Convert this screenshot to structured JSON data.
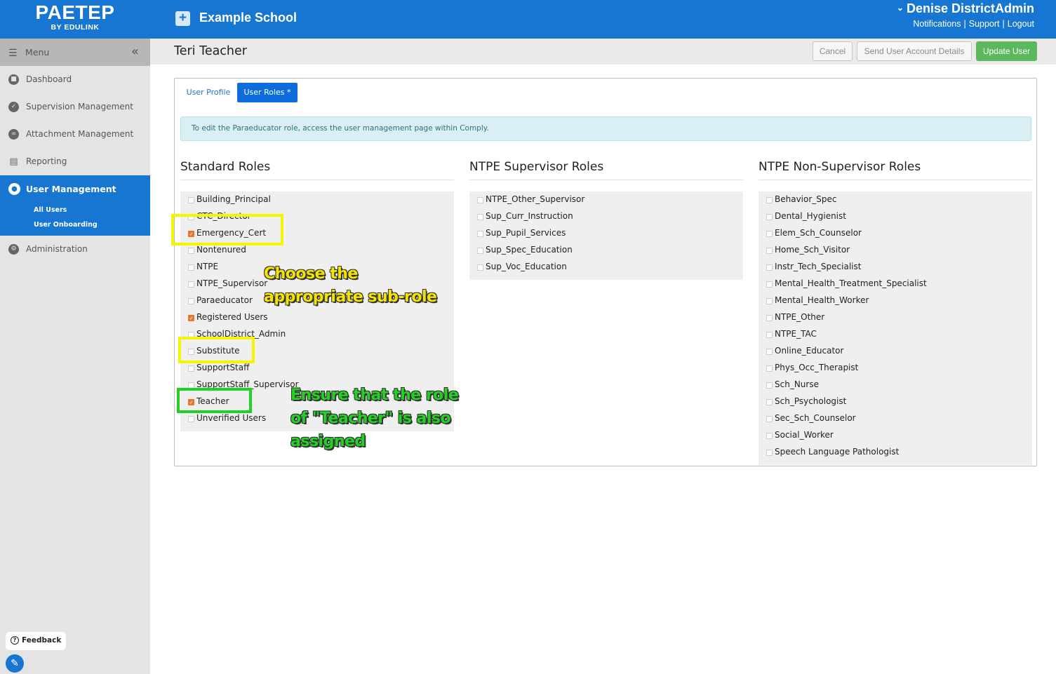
{
  "brand": {
    "logo": "PAETEP",
    "tagline": "BY EDULINK"
  },
  "header": {
    "school_name": "Example School",
    "user_name": "Denise DistrictAdmin",
    "links": [
      "Notifications",
      "Support",
      "Logout"
    ]
  },
  "sidebar": {
    "menu_label": "Menu",
    "items": [
      {
        "label": "Dashboard",
        "icon": "dashboard-icon"
      },
      {
        "label": "Supervision Management",
        "icon": "check-circle-icon"
      },
      {
        "label": "Attachment Management",
        "icon": "paperclip-icon"
      },
      {
        "label": "Reporting",
        "icon": "bar-chart-icon"
      },
      {
        "label": "User Management",
        "icon": "user-icon",
        "active": true
      },
      {
        "label": "Administration",
        "icon": "gear-icon"
      }
    ],
    "sub_items": [
      "All Users",
      "User Onboarding"
    ],
    "feedback_label": "Feedback"
  },
  "page": {
    "title": "Teri Teacher",
    "buttons": {
      "cancel": "Cancel",
      "send": "Send User Account Details",
      "update": "Update User"
    }
  },
  "tabs": [
    {
      "label": "User Profile",
      "active": false
    },
    {
      "label": "User Roles *",
      "active": true
    }
  ],
  "info_message": "To edit the Paraeducator role, access the user management page within Comply.",
  "columns": [
    {
      "title": "Standard Roles",
      "roles": [
        {
          "label": "Building_Principal",
          "checked": false
        },
        {
          "label": "CTC_Director",
          "checked": false
        },
        {
          "label": "Emergency_Cert",
          "checked": true
        },
        {
          "label": "Nontenured",
          "checked": false
        },
        {
          "label": "NTPE",
          "checked": false
        },
        {
          "label": "NTPE_Supervisor",
          "checked": false
        },
        {
          "label": "Paraeducator",
          "checked": false
        },
        {
          "label": "Registered Users",
          "checked": true
        },
        {
          "label": "SchoolDistrict_Admin",
          "checked": false
        },
        {
          "label": "Substitute",
          "checked": false
        },
        {
          "label": "SupportStaff",
          "checked": false
        },
        {
          "label": "SupportStaff_Supervisor",
          "checked": false
        },
        {
          "label": "Teacher",
          "checked": true
        },
        {
          "label": "Unverified Users",
          "checked": false
        }
      ]
    },
    {
      "title": "NTPE Supervisor Roles",
      "roles": [
        {
          "label": "NTPE_Other_Supervisor",
          "checked": false
        },
        {
          "label": "Sup_Curr_Instruction",
          "checked": false
        },
        {
          "label": "Sup_Pupil_Services",
          "checked": false
        },
        {
          "label": "Sup_Spec_Education",
          "checked": false
        },
        {
          "label": "Sup_Voc_Education",
          "checked": false
        }
      ]
    },
    {
      "title": "NTPE Non-Supervisor Roles",
      "roles": [
        {
          "label": "Behavior_Spec",
          "checked": false
        },
        {
          "label": "Dental_Hygienist",
          "checked": false
        },
        {
          "label": "Elem_Sch_Counselor",
          "checked": false
        },
        {
          "label": "Home_Sch_Visitor",
          "checked": false
        },
        {
          "label": "Instr_Tech_Specialist",
          "checked": false
        },
        {
          "label": "Mental_Health_Treatment_Specialist",
          "checked": false
        },
        {
          "label": "Mental_Health_Worker",
          "checked": false
        },
        {
          "label": "NTPE_Other",
          "checked": false
        },
        {
          "label": "NTPE_TAC",
          "checked": false
        },
        {
          "label": "Online_Educator",
          "checked": false
        },
        {
          "label": "Phys_Occ_Therapist",
          "checked": false
        },
        {
          "label": "Sch_Nurse",
          "checked": false
        },
        {
          "label": "Sch_Psychologist",
          "checked": false
        },
        {
          "label": "Sec_Sch_Counselor",
          "checked": false
        },
        {
          "label": "Social_Worker",
          "checked": false
        },
        {
          "label": "Speech Language Pathologist",
          "checked": false
        }
      ]
    }
  ],
  "annotations": {
    "yellow_line1": "Choose the",
    "yellow_line2": "appropriate sub-role",
    "green_line1": "Ensure that the role",
    "green_line2": "of \"Teacher\" is also",
    "green_line3": "assigned"
  },
  "colors": {
    "primary": "#1776d1",
    "success": "#5cb85c",
    "checkbox": "#e8762c",
    "highlight_yellow": "#f5f500",
    "highlight_green": "#22d222"
  }
}
